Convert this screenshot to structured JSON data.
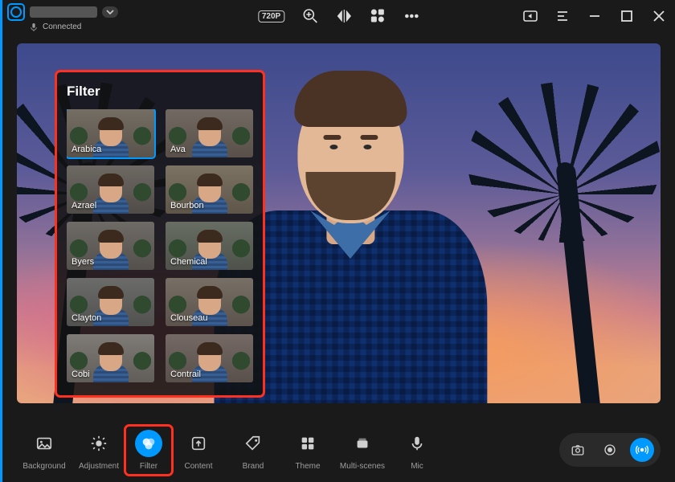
{
  "topbar": {
    "status_label": "Connected",
    "resolution_badge": "720P"
  },
  "filter_panel": {
    "title": "Filter",
    "selected_index": 0,
    "filters": [
      {
        "label": "Arabica"
      },
      {
        "label": "Ava"
      },
      {
        "label": "Azrael"
      },
      {
        "label": "Bourbon"
      },
      {
        "label": "Byers"
      },
      {
        "label": "Chemical"
      },
      {
        "label": "Clayton"
      },
      {
        "label": "Clouseau"
      },
      {
        "label": "Cobi"
      },
      {
        "label": "Contrail"
      }
    ]
  },
  "toolbar": {
    "active_index": 2,
    "highlighted_index": 2,
    "items": [
      {
        "label": "Background"
      },
      {
        "label": "Adjustment"
      },
      {
        "label": "Filter"
      },
      {
        "label": "Content"
      },
      {
        "label": "Brand"
      },
      {
        "label": "Theme"
      },
      {
        "label": "Multi-scenes"
      },
      {
        "label": "Mic"
      }
    ]
  },
  "colors": {
    "accent": "#0099ff",
    "highlight": "#ff3020"
  }
}
